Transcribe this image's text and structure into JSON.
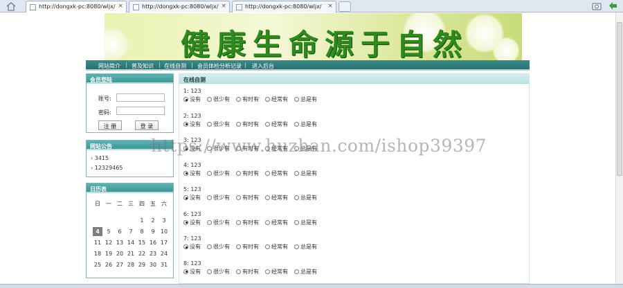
{
  "browser": {
    "tabs": [
      {
        "title": "http://dongxk-pc:8080/wljx/",
        "close": "×",
        "active": true
      },
      {
        "title": "http://dongxk-pc:8080/wljx/",
        "close": "×",
        "active": false
      },
      {
        "title": "http://dongxk-pc:8080/wljx/",
        "close": "×",
        "active": false
      }
    ],
    "tool_icons": [
      "home-icon",
      "add-tab-icon",
      "camera-icon",
      "back-arrow-icon"
    ]
  },
  "banner": {
    "title": "健康生命源于自然"
  },
  "nav": {
    "items": [
      "网站简介",
      "普及知识",
      "在线自测",
      "会员体检分析记录",
      "进入后台"
    ],
    "separator": "|"
  },
  "login": {
    "title": "会员登陆",
    "account_label": "账号:",
    "password_label": "密码:",
    "register_button": "注 册",
    "login_button": "登 录"
  },
  "notice": {
    "title": "网站公告",
    "items": [
      "3415",
      "12329465"
    ],
    "arrow": "›"
  },
  "calendar": {
    "title": "日历表",
    "weekdays": [
      "日",
      "一",
      "二",
      "三",
      "四",
      "五",
      "六"
    ],
    "weeks": [
      [
        "",
        "",
        "",
        "",
        "",
        "1",
        "2",
        "3"
      ],
      [
        "4",
        "5",
        "6",
        "7",
        "8",
        "9",
        "10"
      ],
      [
        "11",
        "12",
        "13",
        "14",
        "15",
        "16",
        "17"
      ],
      [
        "18",
        "19",
        "20",
        "21",
        "22",
        "23",
        "24"
      ],
      [
        "25",
        "26",
        "27",
        "28",
        "29",
        "30",
        "31"
      ]
    ],
    "today": "4"
  },
  "self_test": {
    "title": "在线自测",
    "options": [
      "没有",
      "很少有",
      "有时有",
      "经常有",
      "总是有"
    ],
    "questions": [
      {
        "label": "1: 123",
        "selected": 0
      },
      {
        "label": "2: 123",
        "selected": 0
      },
      {
        "label": "3: 123",
        "selected": 0
      },
      {
        "label": "4: 123",
        "selected": 0
      },
      {
        "label": "5: 123",
        "selected": 0
      },
      {
        "label": "6: 123",
        "selected": 0
      },
      {
        "label": "7: 123",
        "selected": 0
      },
      {
        "label": "8: 123",
        "selected": 0
      }
    ]
  },
  "watermark": "https://www.huzhan.com/ishop39397",
  "colors": {
    "nav": "#2f7c7d",
    "box_head": "#4ea5a6",
    "banner_text": "#2f8a1e"
  }
}
